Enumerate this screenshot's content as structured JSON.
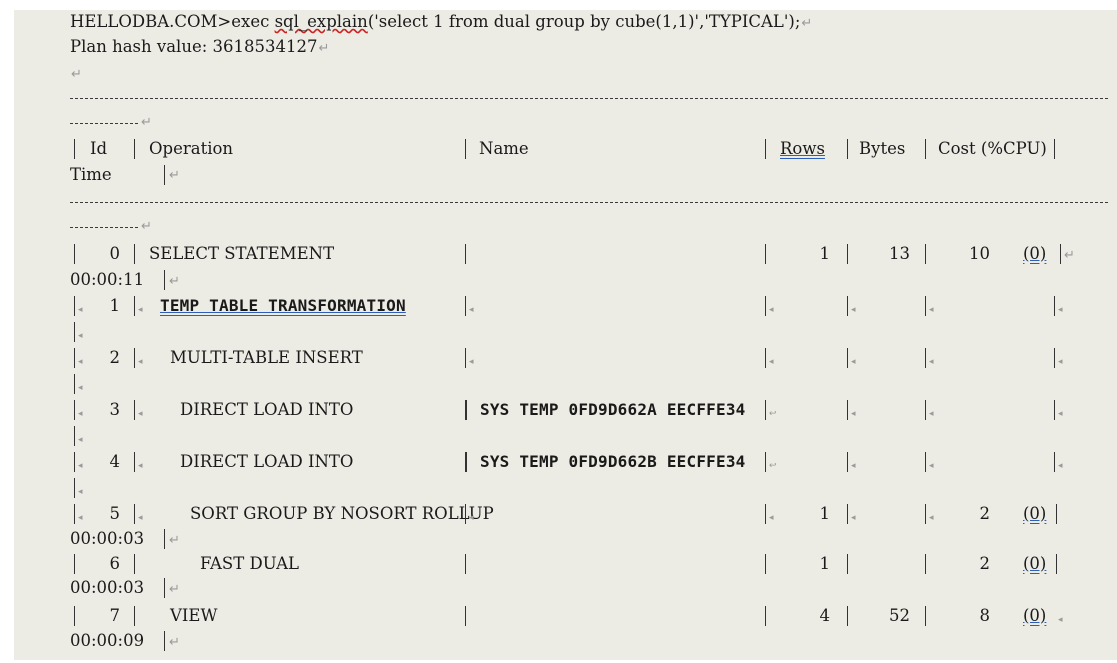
{
  "command": {
    "prompt": "HELLODBA.COM>exec ",
    "fn": "sql_explain",
    "args": "('select 1 from dual group by cube(1,1)','TYPICAL');"
  },
  "plan_hash_label": "Plan hash value: 3618534127",
  "headers": {
    "id": "Id",
    "operation": "Operation",
    "name": "Name",
    "rows": "Rows",
    "bytes": "Bytes",
    "cost": "Cost (%CPU)",
    "time": "Time"
  },
  "rows": [
    {
      "id": "0",
      "operation": "SELECT STATEMENT",
      "name": "",
      "rows": "1",
      "bytes": "13",
      "cost": "10",
      "cpu": "(0)",
      "time": "00:00:11"
    },
    {
      "id": "1",
      "operation": "TEMP TABLE TRANSFORMATION",
      "name": "",
      "rows": "",
      "bytes": "",
      "cost": "",
      "cpu": "",
      "time": ""
    },
    {
      "id": "2",
      "operation": "MULTI-TABLE INSERT",
      "name": "",
      "rows": "",
      "bytes": "",
      "cost": "",
      "cpu": "",
      "time": ""
    },
    {
      "id": "3",
      "operation": "DIRECT LOAD INTO",
      "name": "SYS TEMP 0FD9D662A EECFFE34",
      "rows": "",
      "bytes": "",
      "cost": "",
      "cpu": "",
      "time": ""
    },
    {
      "id": "4",
      "operation": "DIRECT LOAD INTO",
      "name": "SYS TEMP 0FD9D662B EECFFE34",
      "rows": "",
      "bytes": "",
      "cost": "",
      "cpu": "",
      "time": ""
    },
    {
      "id": "5",
      "operation": "SORT GROUP BY NOSORT ROLLUP",
      "name": "",
      "rows": "1",
      "bytes": "",
      "cost": "2",
      "cpu": "(0)",
      "time": "00:00:03"
    },
    {
      "id": "6",
      "operation": "FAST DUAL",
      "name": "",
      "rows": "1",
      "bytes": "",
      "cost": "2",
      "cpu": "(0)",
      "time": "00:00:03"
    },
    {
      "id": "7",
      "operation": "VIEW",
      "name": "",
      "rows": "4",
      "bytes": "52",
      "cost": "8",
      "cpu": "(0)",
      "time": "00:00:09"
    }
  ]
}
